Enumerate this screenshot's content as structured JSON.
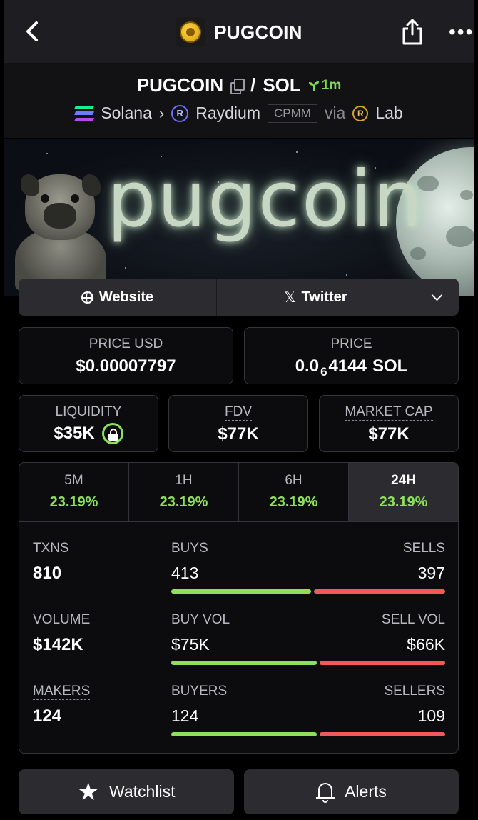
{
  "header": {
    "title": "PUGCOIN"
  },
  "pair": {
    "base": "PUGCOIN",
    "separator": "/",
    "quote": "SOL",
    "age": "1m",
    "chain": "Solana",
    "dex": "Raydium",
    "pool_type": "CPMM",
    "via_label": "via",
    "launchpad": "Lab"
  },
  "banner": {
    "text": "pugcoin"
  },
  "links": {
    "website": "Website",
    "twitter": "Twitter"
  },
  "prices": {
    "usd_label": "PRICE USD",
    "usd_value": "$0.00007797",
    "native_label": "PRICE",
    "native_prefix": "0.0",
    "native_zeros": "6",
    "native_digits": "4144",
    "native_unit": "SOL"
  },
  "metrics": {
    "liquidity_label": "LIQUIDITY",
    "liquidity_value": "$35K",
    "fdv_label": "FDV",
    "fdv_value": "$77K",
    "mcap_label": "MARKET CAP",
    "mcap_value": "$77K"
  },
  "timeframes": [
    {
      "label": "5M",
      "change": "23.19%"
    },
    {
      "label": "1H",
      "change": "23.19%"
    },
    {
      "label": "6H",
      "change": "23.19%"
    },
    {
      "label": "24H",
      "change": "23.19%"
    }
  ],
  "active_timeframe": "24H",
  "stats": {
    "txns_label": "TXNS",
    "txns_value": "810",
    "buys_label": "BUYS",
    "buys_value": "413",
    "sells_label": "SELLS",
    "sells_value": "397",
    "volume_label": "VOLUME",
    "volume_value": "$142K",
    "buy_vol_label": "BUY VOL",
    "buy_vol_value": "$75K",
    "sell_vol_label": "SELL VOL",
    "sell_vol_value": "$66K",
    "makers_label": "MAKERS",
    "makers_value": "124",
    "buyers_label": "BUYERS",
    "buyers_value": "124",
    "sellers_label": "SELLERS",
    "sellers_value": "109",
    "buy_ratio_txns": 0.51,
    "buy_ratio_vol": 0.53,
    "buy_ratio_makers": 0.53
  },
  "actions": {
    "watchlist": "Watchlist",
    "alerts": "Alerts"
  },
  "colors": {
    "positive": "#8ee05a",
    "negative": "#f25858",
    "panel": "#2b2b30"
  }
}
